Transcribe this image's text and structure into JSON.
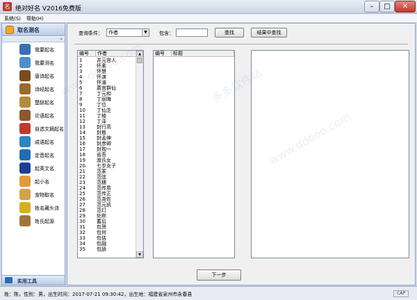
{
  "window": {
    "title": "绝对好名 V2016免费版",
    "app_icon": "名"
  },
  "menu": {
    "items": [
      "系统(S)",
      "帮助(H)"
    ]
  },
  "sidebar": {
    "header": "取名测名",
    "collapse_glyph": "«",
    "items": [
      {
        "label": "我要起名",
        "icon": "baby-icon",
        "color": "#3b6fb6"
      },
      {
        "label": "我要测名",
        "icon": "magnifier-icon",
        "color": "#4f8fc8"
      },
      {
        "label": "唐诗起名",
        "icon": "tang-poem-icon",
        "color": "#7a4a1c"
      },
      {
        "label": "诗经起名",
        "icon": "book-of-songs-icon",
        "color": "#9a6b2a"
      },
      {
        "label": "楚辞起名",
        "icon": "chu-ci-icon",
        "color": "#b38a3f"
      },
      {
        "label": "论语起名",
        "icon": "analects-icon",
        "color": "#8b5a2b"
      },
      {
        "label": "自选文摘起名",
        "icon": "custom-text-icon",
        "color": "#c0392b"
      },
      {
        "label": "成语起名",
        "icon": "idiom-icon",
        "color": "#2e86c1"
      },
      {
        "label": "定音起名",
        "icon": "pronunciation-icon",
        "color": "#1f6fb2"
      },
      {
        "label": "起英文名",
        "icon": "uk-flag-icon",
        "color": "#1c3f95"
      },
      {
        "label": "起小名",
        "icon": "nickname-icon",
        "color": "#e39a3b"
      },
      {
        "label": "宠物取名",
        "icon": "pet-icon",
        "color": "#d4a04a"
      },
      {
        "label": "姓名藏头诗",
        "icon": "acrostic-icon",
        "color": "#d4b01c"
      },
      {
        "label": "姓氏起源",
        "icon": "surname-origin-icon",
        "color": "#a0753b"
      }
    ],
    "footer": "实用工具"
  },
  "search": {
    "condition_label": "查询条件：",
    "condition_value": "作者",
    "contains_label": "包含：",
    "contains_value": "",
    "search_button": "查找",
    "search_in_results_button": "结果中查找"
  },
  "author_list": {
    "columns": [
      "编号",
      "作者"
    ],
    "rows": [
      [
        "1",
        "井元宫人"
      ],
      [
        "2",
        "怀素"
      ],
      [
        "3",
        "怀慧"
      ],
      [
        "4",
        "怀演"
      ],
      [
        "5",
        "怀濬"
      ],
      [
        "6",
        "葛宫群仙"
      ],
      [
        "7",
        "丁元和"
      ],
      [
        "8",
        "丁丽晦"
      ],
      [
        "9",
        "丁位"
      ],
      [
        "10",
        "丁仙芝"
      ],
      [
        "11",
        "丁棱"
      ],
      [
        "12",
        "丁泽"
      ],
      [
        "13",
        "封行高"
      ],
      [
        "14",
        "封敖"
      ],
      [
        "15",
        "封孟绅"
      ],
      [
        "16",
        "封彦卿"
      ],
      [
        "17",
        "封抱一"
      ],
      [
        "18",
        "省吾"
      ],
      [
        "19",
        "渡氏女"
      ],
      [
        "20",
        "七岁女子"
      ],
      [
        "21",
        "范冢"
      ],
      [
        "22",
        "范弦"
      ],
      [
        "23",
        "范穗"
      ],
      [
        "24",
        "范传质"
      ],
      [
        "25",
        "范传正"
      ],
      [
        "26",
        "范尧佐"
      ],
      [
        "27",
        "范元凯"
      ],
      [
        "28",
        "范灯"
      ],
      [
        "29",
        "处默"
      ],
      [
        "30",
        "蓄后"
      ],
      [
        "31",
        "包贺"
      ],
      [
        "32",
        "包何"
      ],
      [
        "33",
        "包佶"
      ],
      [
        "34",
        "包融"
      ],
      [
        "35",
        "包舔"
      ]
    ]
  },
  "title_list": {
    "columns": [
      "编号",
      "标题"
    ]
  },
  "next_button": "下一步",
  "status": {
    "text": "姓：陈，性别：男，出生时间：2017-07-21 09:30:42，出生地：福建省泉州市永春县",
    "caps": "CAP"
  }
}
